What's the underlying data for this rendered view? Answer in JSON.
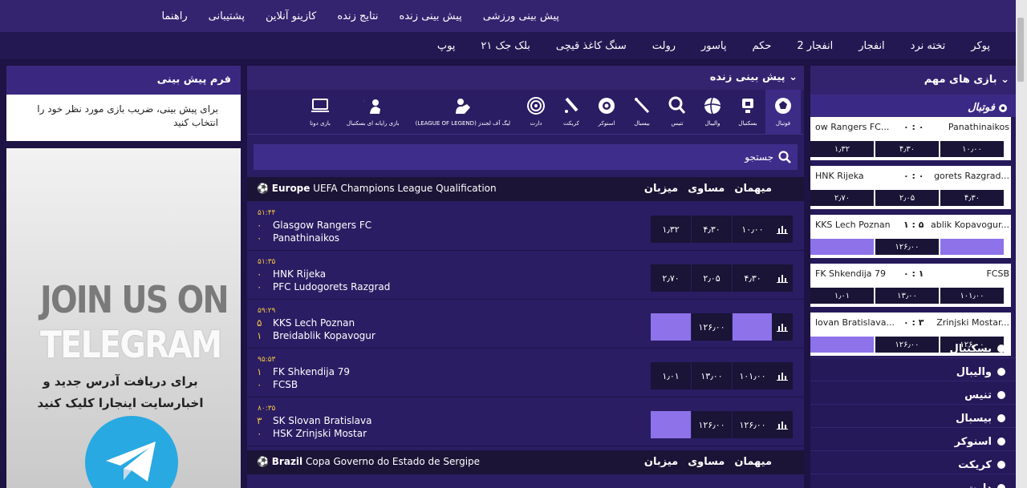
{
  "nav_main": [
    "پیش بینی ورزشی",
    "پیش بینی زنده",
    "نتایج زنده",
    "کازینو آنلاین",
    "پشتیبانی",
    "راهنما"
  ],
  "nav_games": [
    "پوکر",
    "تخته نرد",
    "انفجار",
    "انفجار 2",
    "حکم",
    "پاسور",
    "رولت",
    "سنگ کاغذ قیچی",
    "بلک جک ۲۱",
    "پوپ"
  ],
  "bet_form": {
    "title": "فرم پیش بینی",
    "hint": "برای پیش بینی، ضریب بازی مورد نظر خود را انتخاب کنید"
  },
  "banner": {
    "line1": "JOIN US ON",
    "line2": "TELEGRAM",
    "text": "برای دریافت آدرس جدید و اخبارسایت اینجارا کلیک کنید"
  },
  "live": {
    "title": "پیش بینی زنده",
    "sports": [
      {
        "label": "فوتبال",
        "icon": "soccer-ball-icon"
      },
      {
        "label": "بسکتبال",
        "icon": "basketball-icon"
      },
      {
        "label": "والیبال",
        "icon": "volleyball-icon"
      },
      {
        "label": "تنیس",
        "icon": "tennis-icon"
      },
      {
        "label": "بیسبال",
        "icon": "baseball-bat-icon"
      },
      {
        "label": "اسنوکر",
        "icon": "snooker-icon"
      },
      {
        "label": "کریکت",
        "icon": "cricket-icon"
      },
      {
        "label": "دارت",
        "icon": "dart-icon"
      },
      {
        "label": "لیگ آف لجندز (LEAGUE OF LEGEND)",
        "icon": "esports-icon"
      },
      {
        "label": "بازی رایانه ای بسکتبال",
        "icon": "esports-basketball-icon"
      },
      {
        "label": "بازی دوتا",
        "icon": "computer-icon"
      }
    ],
    "search_placeholder": "جستجو",
    "col_labels": [
      "میهمان",
      "مساوی",
      "میزبان"
    ],
    "leagues": [
      {
        "region": "Europe",
        "name": "UEFA Champions League Qualification",
        "matches": [
          {
            "time": "۵۱:۴۴",
            "home": "Glasgow Rangers FC",
            "away": "Panathinaikos",
            "s1": "۰",
            "s2": "۰",
            "odds": [
              "۱٫۳۲",
              "۴٫۳۰",
              "۱۰٫۰۰"
            ],
            "suspended": [
              false,
              false,
              false
            ]
          },
          {
            "time": "۵۱:۳۵",
            "home": "HNK Rijeka",
            "away": "PFC Ludogorets Razgrad",
            "s1": "۰",
            "s2": "۰",
            "odds": [
              "۲٫۷۰",
              "۲٫۰۵",
              "۴٫۳۰"
            ],
            "suspended": [
              false,
              false,
              false
            ]
          },
          {
            "time": "۵۹:۲۹",
            "home": "KKS Lech Poznan",
            "away": "Breidablik Kopavogur",
            "s1": "۵",
            "s2": "۱",
            "odds": [
              "",
              "۱۲۶٫۰۰",
              ""
            ],
            "suspended": [
              true,
              false,
              true
            ]
          },
          {
            "time": "۹۵:۵۳",
            "home": "FK Shkendija 79",
            "away": "FCSB",
            "s1": "۱",
            "s2": "۰",
            "odds": [
              "۱٫۰۱",
              "۱۳٫۰۰",
              "۱۰۱٫۰۰"
            ],
            "suspended": [
              false,
              false,
              false
            ]
          },
          {
            "time": "۸۰:۳۵",
            "home": "SK Slovan Bratislava",
            "away": "HSK Zrinjski Mostar",
            "s1": "۳",
            "s2": "۰",
            "odds": [
              "",
              "۱۲۶٫۰۰",
              "۱۲۶٫۰۰"
            ],
            "suspended": [
              true,
              false,
              false
            ]
          }
        ]
      },
      {
        "region": "Brazil",
        "name": "Copa Governo do Estado de Sergipe",
        "matches": []
      }
    ]
  },
  "important": {
    "title": "بازی های مهم",
    "active_category": "فوتبال",
    "matches": [
      {
        "home": "Panathinaikos",
        "away": "ow Rangers FC...",
        "score": "۰ : ۰",
        "odds": [
          "۱٫۳۲",
          "۴٫۳۰",
          "۱۰٫۰۰"
        ],
        "suspended": [
          false,
          false,
          false
        ]
      },
      {
        "home": "gorets Razgrad...",
        "away": "HNK Rijeka",
        "score": "۰ : ۰",
        "odds": [
          "۲٫۷۰",
          "۲٫۰۵",
          "۴٫۳۰"
        ],
        "suspended": [
          false,
          false,
          false
        ]
      },
      {
        "home": "ablik Kopavogur...",
        "away": "KKS Lech Poznan",
        "score": "۱ : ۵",
        "odds": [
          "",
          "۱۲۶٫۰۰",
          ""
        ],
        "suspended": [
          true,
          false,
          true
        ]
      },
      {
        "home": "FCSB",
        "away": "FK Shkendija 79",
        "score": "۰ : ۱",
        "odds": [
          "۱٫۰۱",
          "۱۳٫۰۰",
          "۱۰۱٫۰۰"
        ],
        "suspended": [
          false,
          false,
          false
        ]
      },
      {
        "home": "Zrinjski Mostar...",
        "away": "lovan Bratislava...",
        "score": "۰ : ۳",
        "odds": [
          "",
          "۱۲۶٫۰۰",
          "۱۲۶٫۰۰"
        ],
        "suspended": [
          true,
          false,
          false
        ]
      }
    ],
    "categories": [
      "بسکتبال",
      "والیبال",
      "تنیس",
      "بیسبال",
      "اسنوکر",
      "کریکت",
      "دارت"
    ]
  }
}
